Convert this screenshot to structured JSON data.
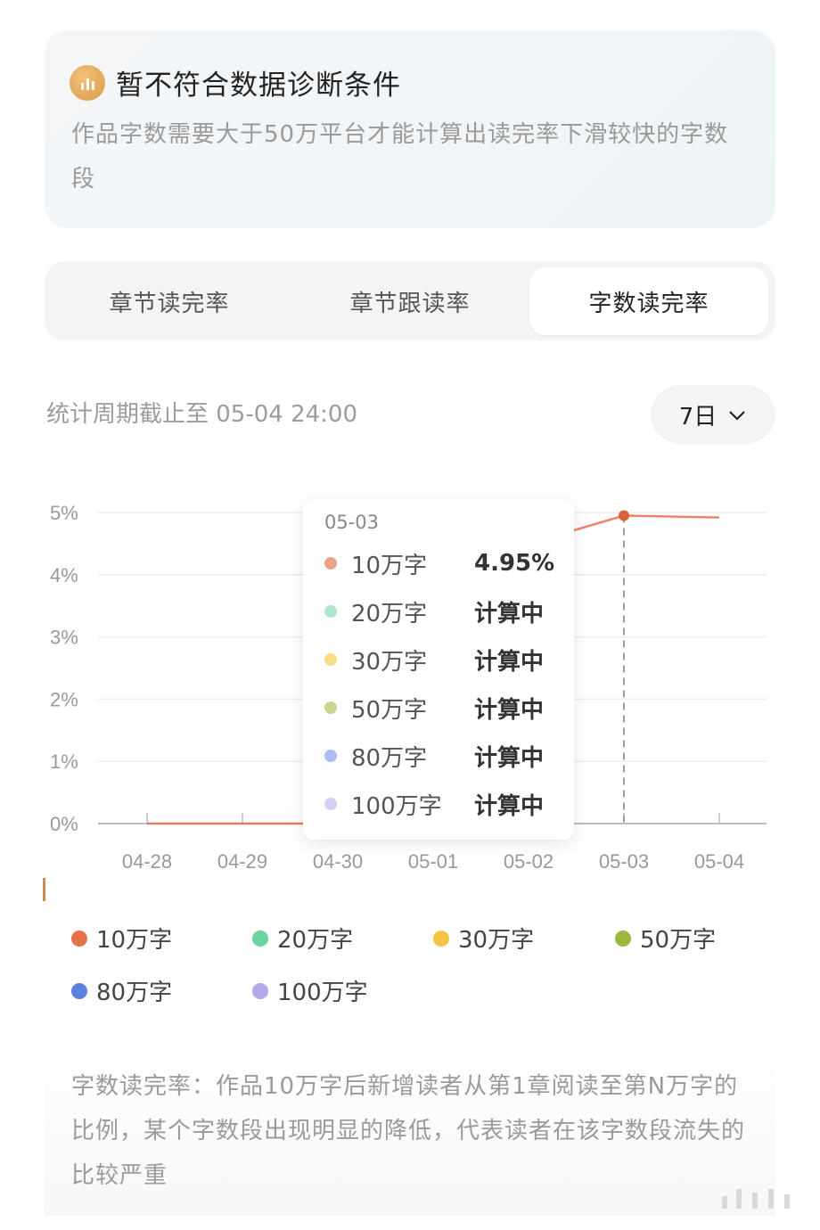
{
  "notice": {
    "icon": "bar-chart-icon",
    "title": "暂不符合数据诊断条件",
    "body": "作品字数需要大于50万平台才能计算出读完率下滑较快的字数段"
  },
  "tabs": [
    {
      "label": "章节读完率",
      "active": false
    },
    {
      "label": "章节跟读率",
      "active": false
    },
    {
      "label": "字数读完率",
      "active": true
    }
  ],
  "period_label": "统计周期截止至 05-04 24:00",
  "range_select": {
    "value": "7日",
    "icon": "chevron-down-icon"
  },
  "chart_data": {
    "type": "line",
    "x": [
      "04-28",
      "04-29",
      "04-30",
      "05-01",
      "05-02",
      "05-03",
      "05-04"
    ],
    "y_ticks": [
      "0%",
      "1%",
      "2%",
      "3%",
      "4%",
      "5%"
    ],
    "ylim": [
      0,
      5
    ],
    "grid": true,
    "series": [
      {
        "name": "10万字",
        "color": "#e8704a",
        "values": [
          0,
          0,
          0,
          2.45,
          4.5,
          4.95,
          4.92
        ]
      },
      {
        "name": "20万字",
        "color": "#6dd4a3",
        "values": []
      },
      {
        "name": "30万字",
        "color": "#f4c542",
        "values": []
      },
      {
        "name": "50万字",
        "color": "#9bb839",
        "values": []
      },
      {
        "name": "80万字",
        "color": "#5d83e0",
        "values": []
      },
      {
        "name": "100万字",
        "color": "#b3a8ea",
        "values": []
      }
    ],
    "highlight_x": "05-03"
  },
  "tooltip": {
    "date": "05-03",
    "rows": [
      {
        "label": "10万字",
        "value": "4.95%",
        "color": "#eaa388"
      },
      {
        "label": "20万字",
        "value": "计算中",
        "color": "#aee6cc"
      },
      {
        "label": "30万字",
        "value": "计算中",
        "color": "#f7dd86"
      },
      {
        "label": "50万字",
        "value": "计算中",
        "color": "#c9d68f"
      },
      {
        "label": "80万字",
        "value": "计算中",
        "color": "#a9bff0"
      },
      {
        "label": "100万字",
        "value": "计算中",
        "color": "#d6d0f5"
      }
    ]
  },
  "description": "字数读完率：作品10万字后新增读者从第1章阅读至第N万字的比例，某个字数段出现明显的降低，代表读者在该字数段流失的比较严重"
}
